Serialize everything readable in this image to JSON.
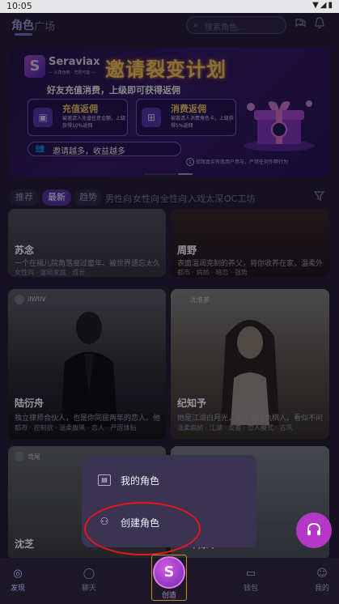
{
  "status_bar": {
    "time": "10:05",
    "icons": "▼◢▮"
  },
  "header": {
    "tab_role": "角色",
    "tab_square": "广场",
    "search_placeholder": "搜索角色..."
  },
  "banner": {
    "brand": "Seraviax",
    "brand_sub": "— 从角色到 · 无限可能 —",
    "title": "邀请裂变计划",
    "subtitle": "好友充值消费，上级即可获得返佣",
    "card_left": {
      "title": "充值返佣",
      "desc": "被邀请人充值任意金额，上级获得10%返佣"
    },
    "card_right": {
      "title": "消费返佣",
      "desc": "被邀请人消费角色卡，上级获得5%返佣"
    },
    "footer": "邀请越多，收益越多",
    "note_num": "1",
    "note": "仅限真实有效用户参与，严禁任何作弊行为"
  },
  "filters": {
    "chips": [
      "推荐",
      "最新",
      "趋势"
    ],
    "texts": [
      "男性向",
      "女性向",
      "全性向",
      "入戏太深",
      "OC工坊"
    ],
    "active": "最新"
  },
  "cards": [
    {
      "name": "苏念",
      "desc": "一个在福儿院角落度过童年、被世界遗忘太久",
      "tags": "女性向 · 富硕家庭 · 成长"
    },
    {
      "name": "周野",
      "desc": "表面温润克制的养父，将你收养在家，温柔外",
      "tags": "都市 · 病娇 · 暗恋 · 强势"
    },
    {
      "name": "陆衍舟",
      "desc": "独立律师合伙人，也是你同居两年的恋人。他",
      "tags": "都市 · 控制欲 · 温柔腹黑 · 恋人 · 严厉体贴",
      "author": "iIWIIV"
    },
    {
      "name": "纪知予",
      "desc": "她是江湖白月光，也是暗夜执棋人。看似不问",
      "tags": "温柔病娇 · 江湖 · 反差 · 恋人模式 · 古风",
      "author": "沈淮茶"
    },
    {
      "name": "沈芝",
      "author": "鸢尾"
    },
    {
      "name": "印陈平"
    }
  ],
  "popup": {
    "my_roles": "我的角色",
    "create_role": "创建角色"
  },
  "navbar": {
    "discover": "发现",
    "chat": "聊天",
    "create": "创造",
    "wallet": "钱包",
    "mine": "我的"
  },
  "colors": {
    "accent": "#7a58c9",
    "highlight_ring": "#e8131b",
    "fab": "#b438c5",
    "banner_title": "#ffd36b"
  }
}
